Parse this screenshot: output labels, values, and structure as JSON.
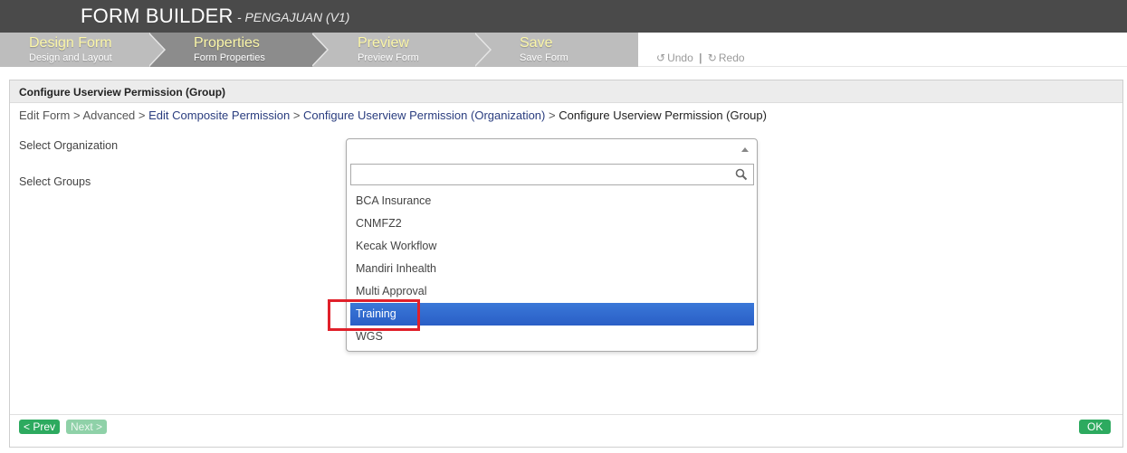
{
  "header": {
    "title": "FORM BUILDER",
    "subtitle": "- PENGAJUAN (V1)"
  },
  "steps": [
    {
      "title": "Design Form",
      "subtitle": "Design and Layout"
    },
    {
      "title": "Properties",
      "subtitle": "Form Properties"
    },
    {
      "title": "Preview",
      "subtitle": "Preview Form"
    },
    {
      "title": "Save",
      "subtitle": "Save Form"
    }
  ],
  "active_step": "Properties",
  "toolbar": {
    "undo_label": "Undo",
    "separator": "|",
    "redo_label": "Redo"
  },
  "panel": {
    "title": "Configure Userview Permission (Group)",
    "breadcrumb": {
      "edit_form": "Edit Form",
      "advanced": "Advanced",
      "edit_composite": "Edit Composite Permission",
      "configure_org": "Configure Userview Permission (Organization)",
      "current": "Configure Userview Permission (Group)",
      "sep": ">"
    },
    "labels": {
      "select_organization": "Select Organization",
      "select_groups": "Select Groups"
    }
  },
  "dropdown": {
    "search_value": "",
    "options": [
      "BCA Insurance",
      "CNMFZ2",
      "Kecak Workflow",
      "Mandiri Inhealth",
      "Multi Approval",
      "Training",
      "WGS"
    ],
    "highlighted": "Training"
  },
  "footer": {
    "prev_label": "< Prev",
    "next_label": "Next >",
    "ok_label": "OK"
  },
  "colors": {
    "header_bg": "#4a4a4a",
    "step_active": "#8c8c8c",
    "step_inactive": "#bdbdbd",
    "step_title": "#fbf6a8",
    "selected_option": "#2a5fc6",
    "annotation_box": "#e0202a",
    "button_green": "#2daa5f"
  }
}
